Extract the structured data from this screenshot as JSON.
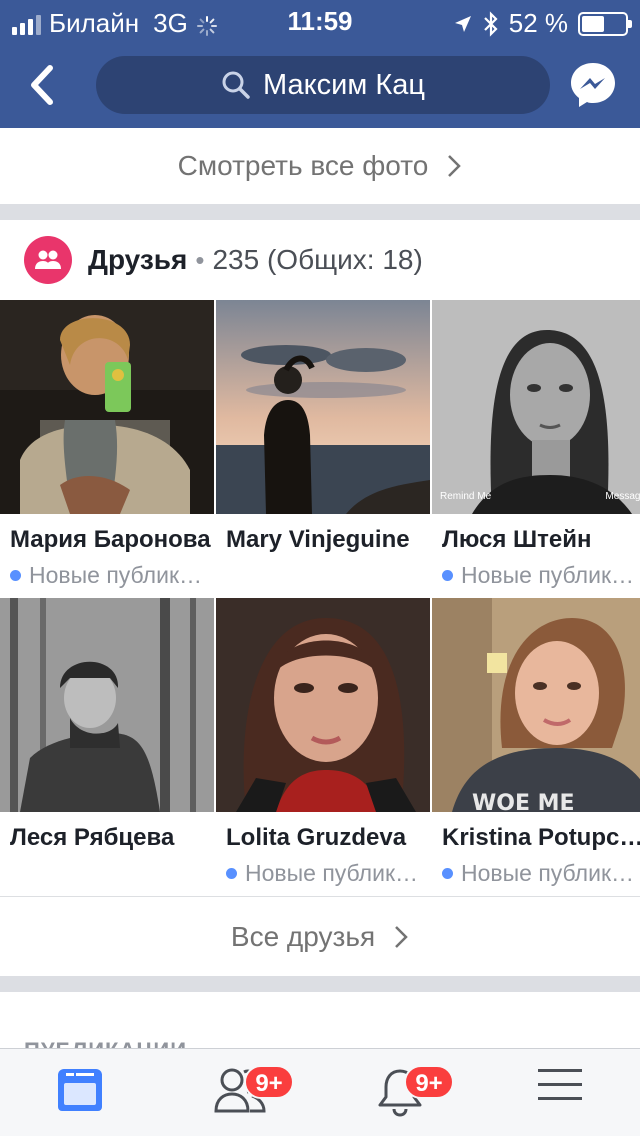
{
  "status_bar": {
    "carrier": "Билайн",
    "network": "3G",
    "time": "11:59",
    "battery": "52 %",
    "battery_level": 0.52
  },
  "nav": {
    "search_text": "Максим Кац",
    "icons": [
      "back-chevron-icon",
      "search-icon",
      "messenger-icon"
    ]
  },
  "photos": {
    "see_all_label": "Смотреть все фото"
  },
  "friends": {
    "title": "Друзья",
    "separator": "•",
    "count_text": "235 (Общих: 18)",
    "items": [
      {
        "name": "Мария Баронова",
        "status": "Новые публик…",
        "has_status": true
      },
      {
        "name": "Mary Vinjeguine",
        "status": "",
        "has_status": false
      },
      {
        "name": "Люся Штейн",
        "status": "Новые публик…",
        "has_status": true,
        "overlay_left": "Remind Me",
        "overlay_right": "Message"
      },
      {
        "name": "Леся Рябцева",
        "status": "",
        "has_status": false
      },
      {
        "name": "Lolita Gruzdeva",
        "status": "Новые публик…",
        "has_status": true
      },
      {
        "name": "Kristina Potupc…",
        "status": "Новые публик…",
        "has_status": true
      }
    ],
    "all_friends_label": "Все друзья"
  },
  "publications": {
    "label": "ПУБЛИКАЦИИ"
  },
  "tabbar": {
    "tabs": [
      {
        "name": "news-feed",
        "icon": "news-feed-icon",
        "badge": ""
      },
      {
        "name": "friend-requests",
        "icon": "friends-icon",
        "badge": "9+"
      },
      {
        "name": "notifications",
        "icon": "bell-icon",
        "badge": "9+"
      },
      {
        "name": "menu",
        "icon": "hamburger-icon",
        "badge": ""
      }
    ]
  },
  "colors": {
    "brand": "#3b5998",
    "friends_icon": "#e9356b",
    "badge": "#fa3e3e",
    "active_tab": "#4080ff",
    "new_dot": "#5890ff"
  }
}
